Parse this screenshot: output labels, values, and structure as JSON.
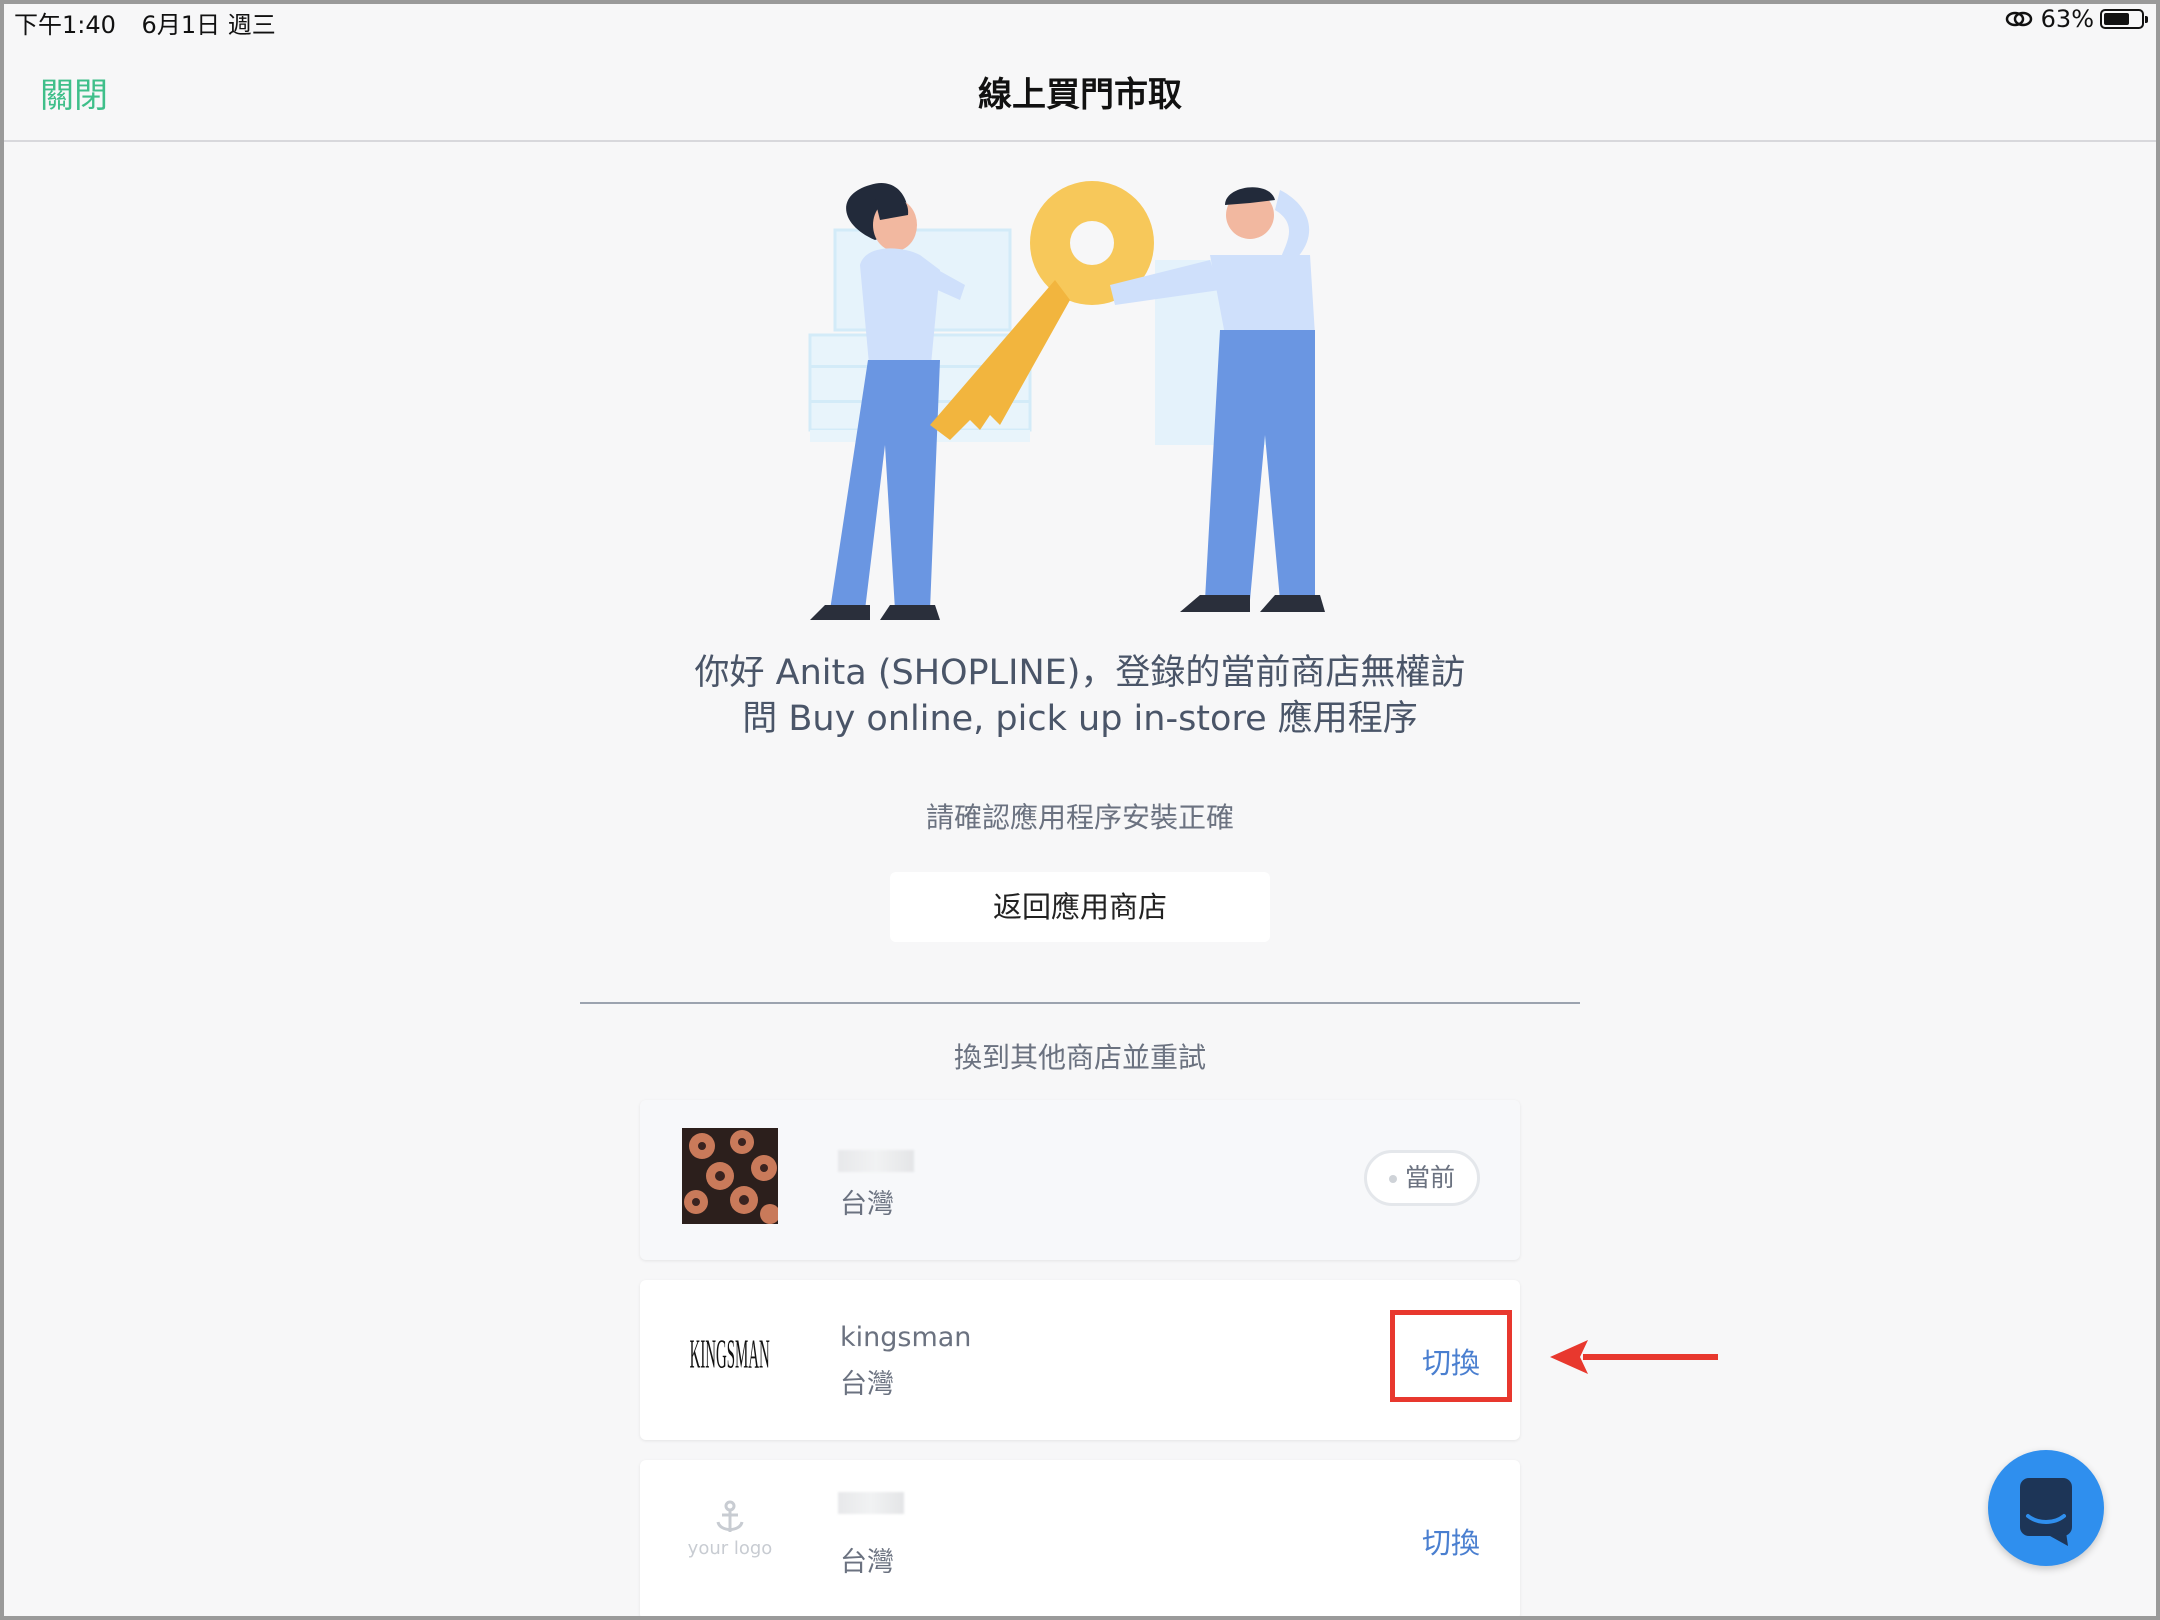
{
  "status_bar": {
    "time": "下午1:40",
    "date": "6月1日 週三",
    "battery": "63%"
  },
  "nav": {
    "close_label": "關閉",
    "title": "線上買門市取"
  },
  "message": {
    "line1": "你好 Anita (SHOPLINE)，登錄的當前商店無權訪",
    "line2": "問 Buy online, pick up in-store 應用程序",
    "sub": "請確認應用程序安裝正確",
    "back_button": "返回應用商店"
  },
  "switch_section": {
    "title": "換到其他商店並重試"
  },
  "stores": [
    {
      "name": "",
      "country": "台灣",
      "action": "當前"
    },
    {
      "name": "kingsman",
      "country": "台灣",
      "action": "切換",
      "logo_text": "KINGSMAN"
    },
    {
      "name": "",
      "country": "台灣",
      "action": "切換",
      "logo_text": "your logo"
    }
  ],
  "colors": {
    "accent_green": "#3fbf8a",
    "link_blue": "#4a7fd0",
    "chat_blue": "#2f8fee",
    "highlight_red": "#e8382e"
  },
  "icons": {
    "chat": "chat-bubble-icon",
    "link": "link-icon",
    "battery": "battery-icon"
  }
}
